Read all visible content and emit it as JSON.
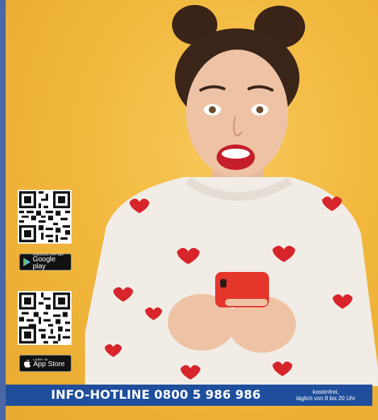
{
  "colors": {
    "background": "#f2b83e",
    "hotline_bar": "#1f4e9c",
    "left_bar": "#4a67a8",
    "sweater": "#f1ece6",
    "hearts": "#d8242b",
    "phone": "#e5362c"
  },
  "badges": {
    "google_play": {
      "small": "ANDROID APP BEI",
      "big": "Google play",
      "icon": "play-triangle-icon"
    },
    "app_store": {
      "small": "Laden im",
      "big": "App Store",
      "icon": "apple-icon"
    }
  },
  "hotline": {
    "label": "INFO-HOTLINE 0800 5 986 986",
    "note_line1": "kostenfrei,",
    "note_line2": "täglich von 8 bis 20 Uhr"
  }
}
